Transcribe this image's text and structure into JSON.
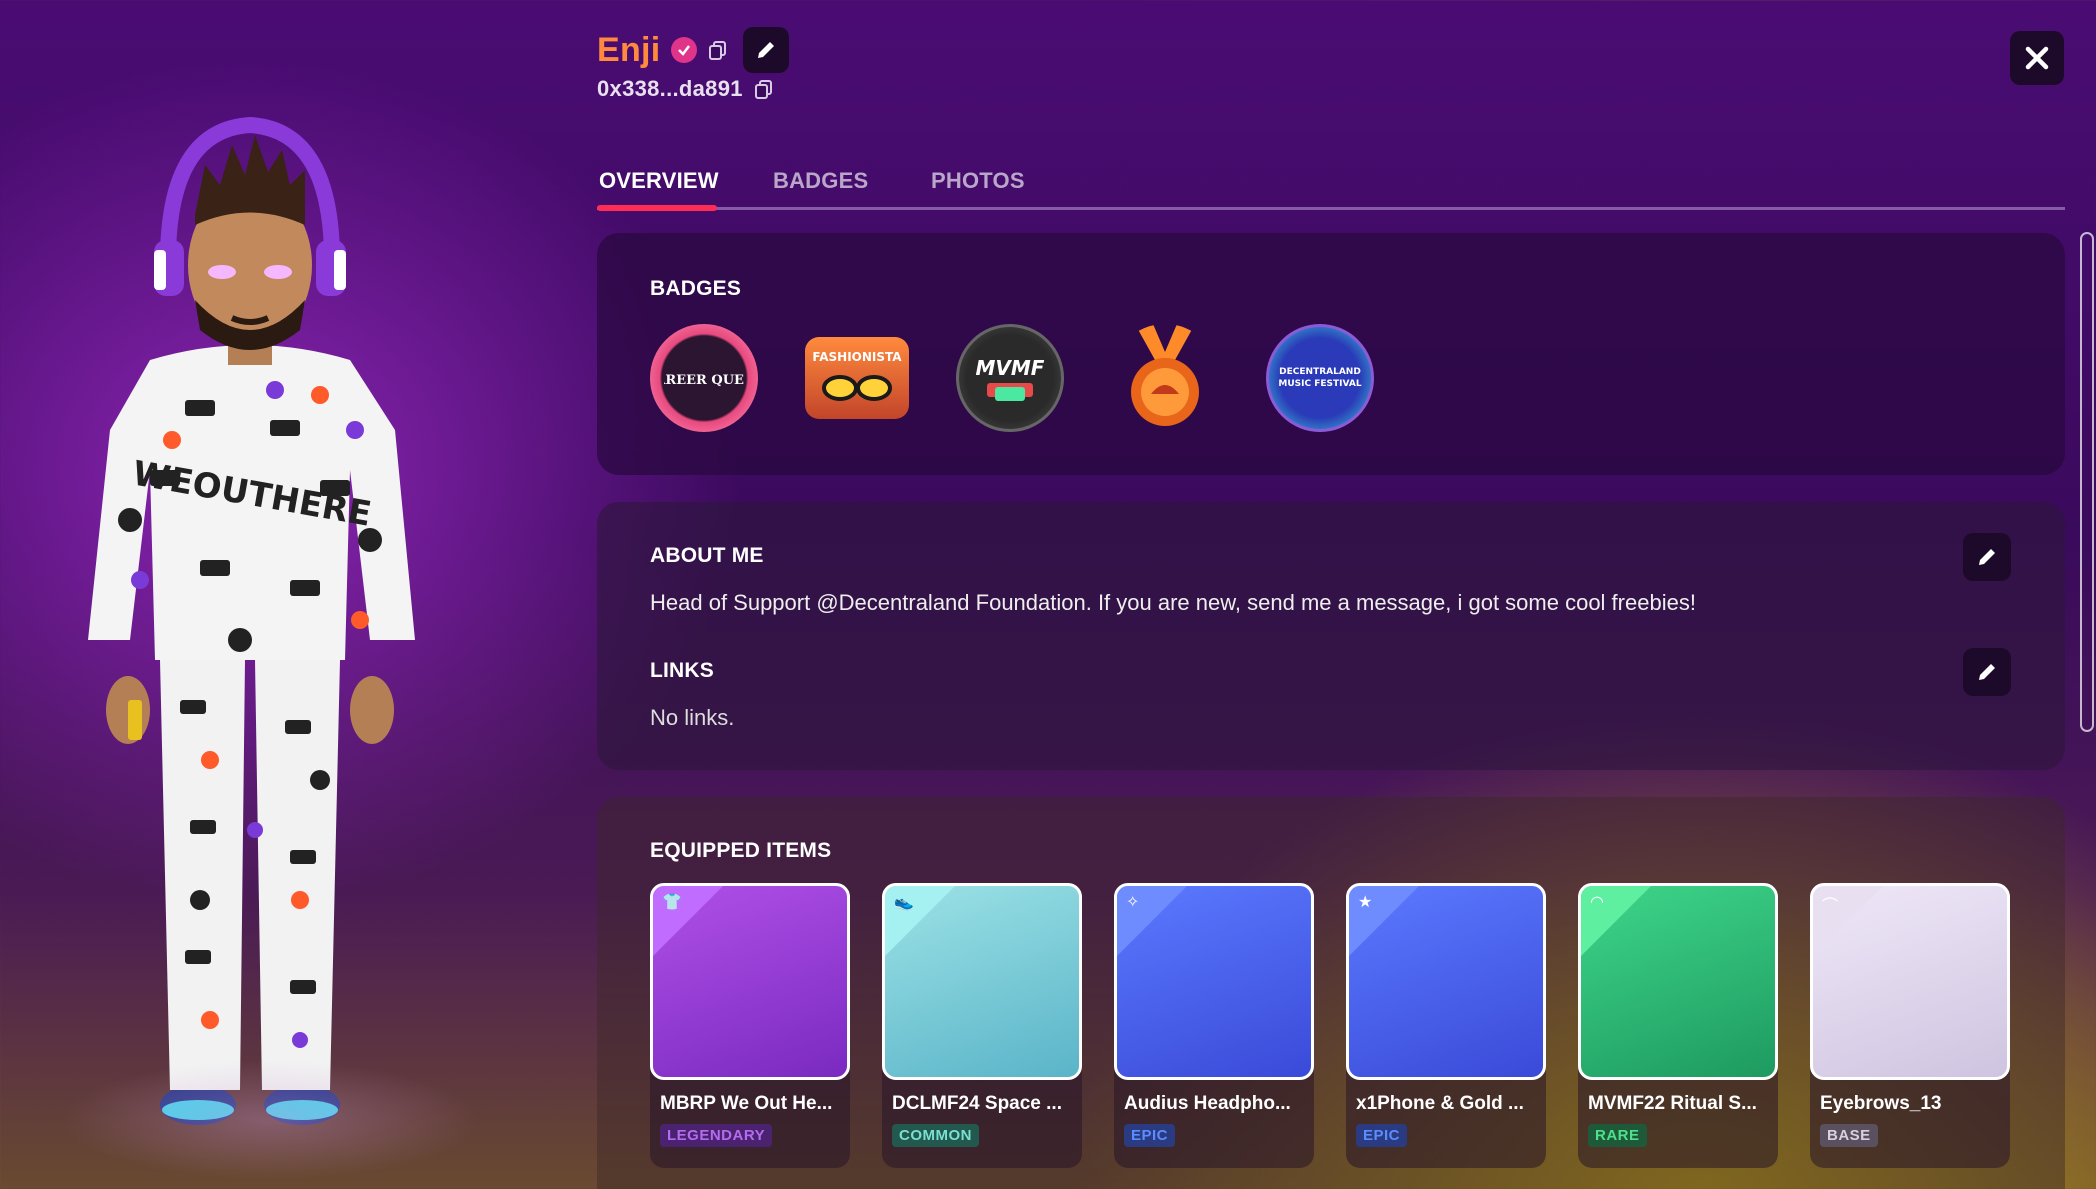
{
  "profile": {
    "name": "Enji",
    "address": "0x338...da891"
  },
  "tabs": [
    {
      "label": "OVERVIEW",
      "active": true
    },
    {
      "label": "BADGES",
      "active": false
    },
    {
      "label": "PHOTOS",
      "active": false
    }
  ],
  "badges_section": {
    "title": "BADGES",
    "badges": [
      {
        "name": "Career Quest",
        "icon": "career-quest-badge",
        "colors": [
          "#e8497e",
          "#2b1530"
        ]
      },
      {
        "name": "Fashionista",
        "icon": "fashionista-badge",
        "colors": [
          "#ff7a3d",
          "#c2452a"
        ]
      },
      {
        "name": "MVMF",
        "icon": "mvmf-badge",
        "colors": [
          "#3a3a3a",
          "#111"
        ]
      },
      {
        "name": "Medal",
        "icon": "medal-badge",
        "colors": [
          "#ff8a2a",
          "#b8461a"
        ]
      },
      {
        "name": "Decentraland Music Festival",
        "icon": "music-festival-badge",
        "colors": [
          "#3a6bd8",
          "#1a1a6e"
        ]
      }
    ]
  },
  "about": {
    "title": "ABOUT ME",
    "text": "Head of Support @Decentraland Foundation. If you are new, send me a message, i got some cool freebies!"
  },
  "links": {
    "title": "LINKS",
    "text": "No links."
  },
  "equipped": {
    "title": "EQUIPPED ITEMS",
    "items": [
      {
        "name": "MBRP We Out He...",
        "rarity": "LEGENDARY",
        "rarity_color": "#b36cf0",
        "rarity_bg": "#4b2270",
        "bg": [
          "#b050e8",
          "#7a2ac0"
        ],
        "corner": "#c06cff",
        "icon": "shirt-icon"
      },
      {
        "name": "DCLMF24 Space ...",
        "rarity": "COMMON",
        "rarity_color": "#79e0d0",
        "rarity_bg": "#23584f",
        "bg": [
          "#9ce2e6",
          "#5ab4c8"
        ],
        "corner": "#a5f0f0",
        "icon": "shoes-icon"
      },
      {
        "name": "Audius Headpho...",
        "rarity": "EPIC",
        "rarity_color": "#5b8cff",
        "rarity_bg": "#2a3b82",
        "bg": [
          "#5b7aff",
          "#3a4ad8"
        ],
        "corner": "#6f8cff",
        "icon": "earring-icon"
      },
      {
        "name": "x1Phone & Gold ...",
        "rarity": "EPIC",
        "rarity_color": "#5b8cff",
        "rarity_bg": "#2a3b82",
        "bg": [
          "#5b7aff",
          "#3a4ad8"
        ],
        "corner": "#6f8cff",
        "icon": "accessory-icon"
      },
      {
        "name": "MVMF22 Ritual S...",
        "rarity": "RARE",
        "rarity_color": "#4ee08a",
        "rarity_bg": "#1e5a3a",
        "bg": [
          "#3ed68a",
          "#1e9a60"
        ],
        "corner": "#5ef0a0",
        "icon": "hair-icon"
      },
      {
        "name": "Eyebrows_13",
        "rarity": "BASE",
        "rarity_color": "#d8d0e0",
        "rarity_bg": "#5a5060",
        "bg": [
          "#efe8f8",
          "#cfc4e0"
        ],
        "corner": "#e8e0f0",
        "icon": "eyebrows-icon"
      }
    ]
  },
  "colors": {
    "accent": "#ff2d55",
    "name": "#ff8a3d",
    "verified": "#e0338a"
  }
}
